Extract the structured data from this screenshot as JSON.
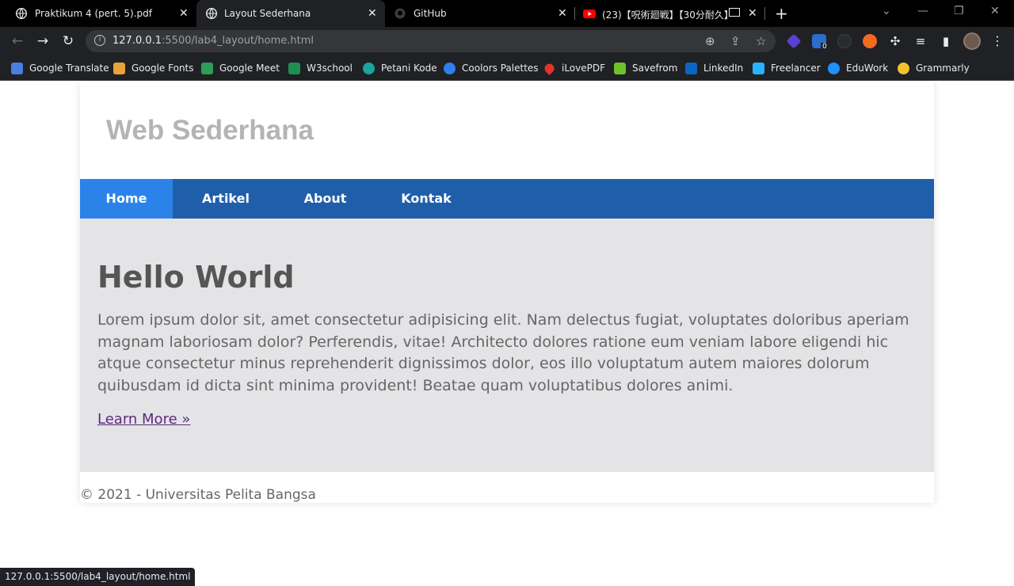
{
  "browser": {
    "tabs": [
      {
        "title": "Praktikum 4 (pert. 5).pdf",
        "icon": "globe-icon",
        "active": false
      },
      {
        "title": "Layout Sederhana",
        "icon": "globe-icon",
        "active": true
      },
      {
        "title": "GitHub",
        "icon": "github-icon",
        "active": false
      },
      {
        "title": "(23)【呪術廻戦】【30分耐久】",
        "icon": "youtube-icon",
        "active": false
      }
    ],
    "address": {
      "host": "127.0.0.1",
      "path": ":5500/lab4_layout/home.html"
    },
    "extension_badge": "0",
    "bookmarks": [
      {
        "label": "Google Translate",
        "color": "#4a7fe0"
      },
      {
        "label": "Google Fonts",
        "color": "#e8a33c"
      },
      {
        "label": "Google Meet",
        "color": "#2f9c58"
      },
      {
        "label": "W3school",
        "color": "#1f8f4f"
      },
      {
        "label": "Petani Kode",
        "color": "#1aa59a"
      },
      {
        "label": "Coolors Palettes",
        "color": "#2d7ff0"
      },
      {
        "label": "iLovePDF",
        "color": "#e5322d"
      },
      {
        "label": "Savefrom",
        "color": "#6fc12b"
      },
      {
        "label": "LinkedIn",
        "color": "#0a66c2"
      },
      {
        "label": "Freelancer",
        "color": "#29b2fe"
      },
      {
        "label": "EduWork",
        "color": "#1e90ff"
      },
      {
        "label": "Grammarly",
        "color": "#f2c12e"
      }
    ],
    "status_url": "127.0.0.1:5500/lab4_layout/home.html"
  },
  "page": {
    "site_title": "Web Sederhana",
    "nav": [
      {
        "label": "Home",
        "active": true
      },
      {
        "label": "Artikel",
        "active": false
      },
      {
        "label": "About",
        "active": false
      },
      {
        "label": "Kontak",
        "active": false
      }
    ],
    "hero": {
      "heading": "Hello World",
      "text": "Lorem ipsum dolor sit, amet consectetur adipisicing elit. Nam delectus fugiat, voluptates doloribus aperiam magnam laboriosam dolor? Perferendis, vitae! Architecto dolores ratione eum veniam labore eligendi hic atque consectetur minus reprehenderit dignissimos dolor, eos illo voluptatum autem maiores dolorum quibusdam id dicta sint minima provident! Beatae quam voluptatibus dolores animi.",
      "link": "Learn More »"
    },
    "footer": "© 2021 - Universitas Pelita Bangsa"
  },
  "colors": {
    "nav_bg": "#1f5faa",
    "nav_active": "#2b83ea",
    "hero_bg": "#e4e4e7",
    "title": "#b4b4b4",
    "link": "#5a2a82"
  }
}
